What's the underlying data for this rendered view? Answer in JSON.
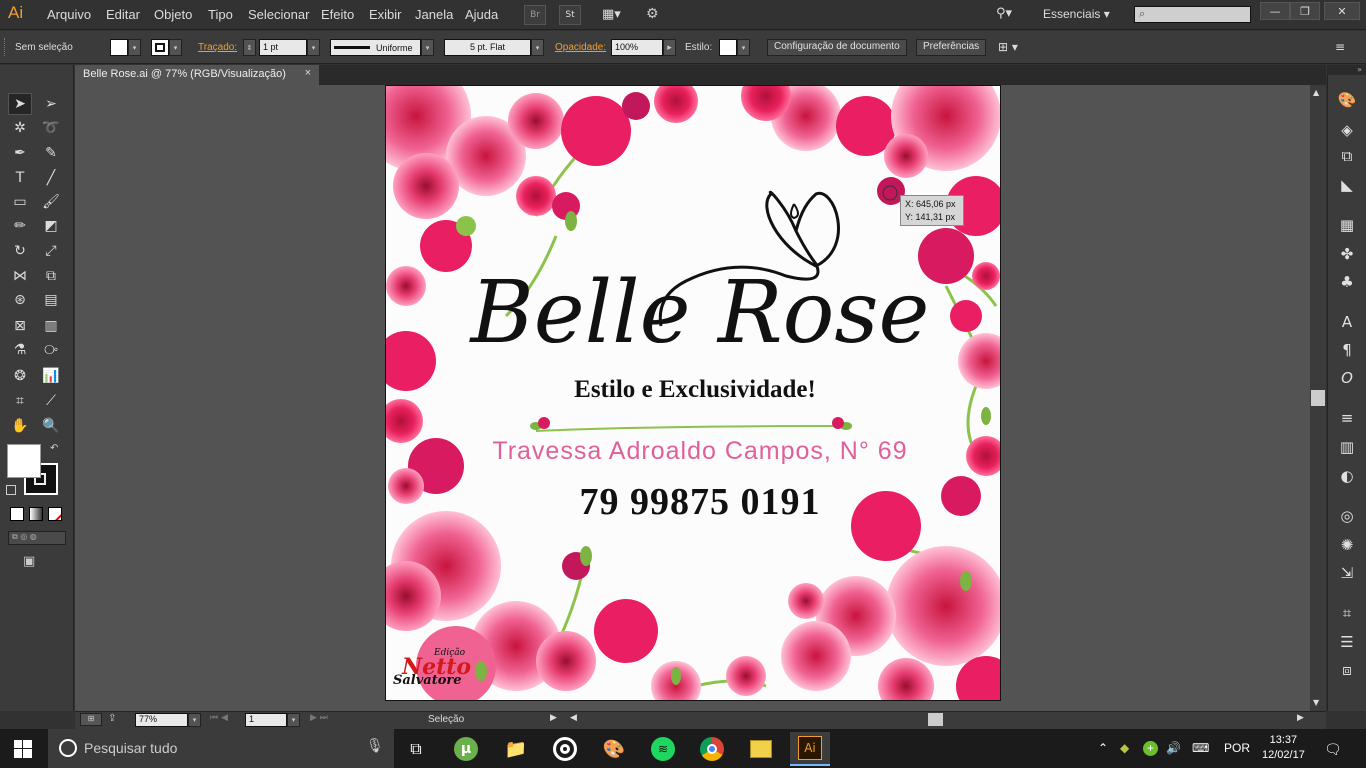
{
  "app": {
    "logo": "Ai"
  },
  "menu": [
    "Arquivo",
    "Editar",
    "Objeto",
    "Tipo",
    "Selecionar",
    "Efeito",
    "Exibir",
    "Janela",
    "Ajuda"
  ],
  "menubar_buttons": [
    "Br",
    "St"
  ],
  "workspace": {
    "label": "Essenciais",
    "search_placeholder": ""
  },
  "control": {
    "selection": "Sem seleção",
    "stroke_label": "Traçado:",
    "stroke_value": "1 pt",
    "profile": "Uniforme",
    "brush": "5 pt. Flat",
    "opacity_label": "Opacidade:",
    "opacity_value": "100%",
    "style_label": "Estilo:",
    "doc_settings": "Configuração de documento",
    "prefs": "Preferências"
  },
  "tab": {
    "title": "Belle Rose.ai @ 77% (RGB/Visualização)",
    "close": "×"
  },
  "artwork": {
    "brand": "Belle Rose",
    "slogan": "Estilo e Exclusividade!",
    "address": "Travessa Adroaldo Campos, N° 69",
    "phone": "79 99875 0191",
    "signature_top": "Edição",
    "signature_name": "Netto",
    "signature_last": "Salvatore"
  },
  "tooltip": {
    "x": "X: 645,06 px",
    "y": "Y: 141,31 px"
  },
  "status": {
    "zoom": "77%",
    "page": "1",
    "tool": "Seleção"
  },
  "taskbar": {
    "search_placeholder": "Pesquisar tudo",
    "language": "POR",
    "time": "13:37",
    "date": "12/02/17"
  },
  "colors": {
    "accent": "#f29d2c",
    "flower_pink": "#e8457e",
    "address_pink": "#e0609a"
  }
}
